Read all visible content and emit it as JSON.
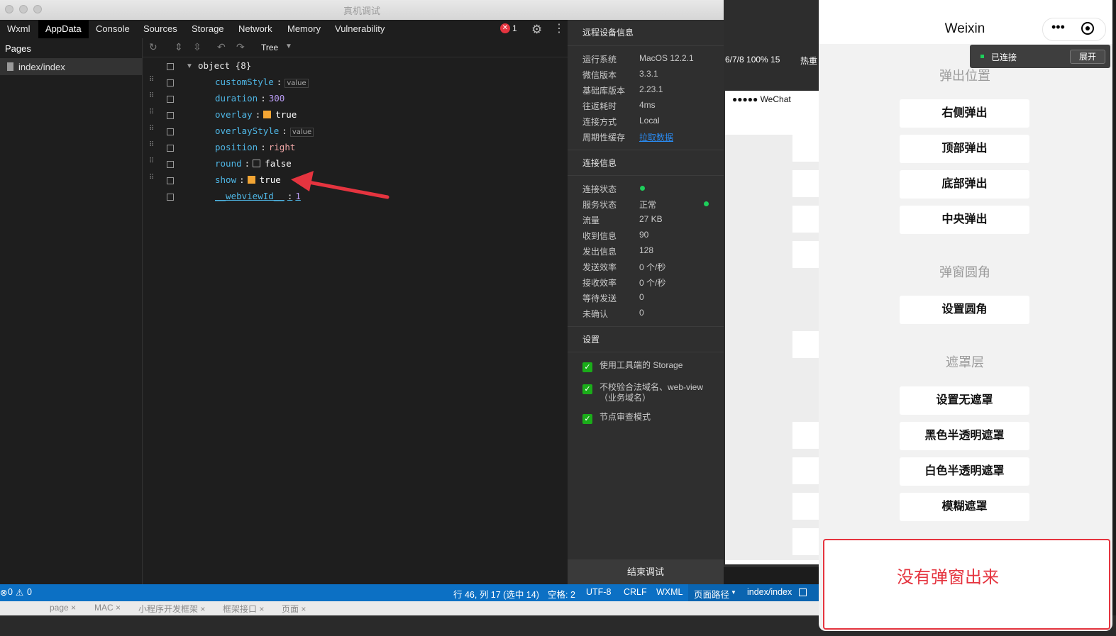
{
  "window": {
    "title": "真机调试"
  },
  "tabs": [
    {
      "label": "Wxml",
      "active": false
    },
    {
      "label": "AppData",
      "active": true
    },
    {
      "label": "Console",
      "active": false
    },
    {
      "label": "Sources",
      "active": false
    },
    {
      "label": "Storage",
      "active": false
    },
    {
      "label": "Network",
      "active": false
    },
    {
      "label": "Memory",
      "active": false
    },
    {
      "label": "Vulnerability",
      "active": false
    }
  ],
  "errors": {
    "count": "1"
  },
  "pages": {
    "title": "Pages",
    "items": [
      "index/index"
    ]
  },
  "toolbar": {
    "view_mode": "Tree"
  },
  "appdata": {
    "root": "object {8}",
    "rows": [
      {
        "key": "customStyle",
        "value": "value",
        "type": "tag"
      },
      {
        "key": "duration",
        "value": "300",
        "type": "num"
      },
      {
        "key": "overlay",
        "value": "true",
        "type": "bool-on"
      },
      {
        "key": "overlayStyle",
        "value": "value",
        "type": "tag"
      },
      {
        "key": "position",
        "value": "right",
        "type": "str"
      },
      {
        "key": "round",
        "value": "false",
        "type": "bool-off"
      },
      {
        "key": "show",
        "value": "true",
        "type": "bool-on"
      },
      {
        "key": "__webviewId__",
        "value": "1",
        "type": "num"
      }
    ]
  },
  "remote": {
    "title": "远程设备信息",
    "rows": [
      {
        "k": "运行系统",
        "v": "MacOS 12.2.1"
      },
      {
        "k": "微信版本",
        "v": "3.3.1"
      },
      {
        "k": "基础库版本",
        "v": "2.23.1"
      },
      {
        "k": "往返耗时",
        "v": "4ms"
      },
      {
        "k": "连接方式",
        "v": "Local"
      },
      {
        "k": "周期性缓存",
        "v": "拉取数据"
      }
    ]
  },
  "connection": {
    "title": "连接信息",
    "rows": [
      {
        "k": "连接状态",
        "v": ""
      },
      {
        "k": "服务状态",
        "v": "正常"
      },
      {
        "k": "流量",
        "v": "27 KB"
      },
      {
        "k": "收到信息",
        "v": "90"
      },
      {
        "k": "发出信息",
        "v": "128"
      },
      {
        "k": "发送效率",
        "v": "0 个/秒"
      },
      {
        "k": "接收效率",
        "v": "0 个/秒"
      },
      {
        "k": "等待发送",
        "v": "0"
      },
      {
        "k": "未确认",
        "v": "0"
      }
    ]
  },
  "settings": {
    "title": "设置",
    "items": [
      "使用工具端的 Storage",
      "不校验合法域名、web-view（业务域名）",
      "节点审查模式"
    ]
  },
  "end_debug": "结束调试",
  "statusbar": {
    "problems_err": "0",
    "problems_warn": "0",
    "cursor": "行 46, 列 17 (选中 14)",
    "spaces": "空格: 2",
    "encoding": "UTF-8",
    "eol": "CRLF",
    "lang": "WXML",
    "page_path_label": "页面路径",
    "page_path": "index/index"
  },
  "bottom_tabs": [
    "page",
    "MAC",
    "小程序开发框架",
    "框架接口",
    "页面"
  ],
  "behind": {
    "toolbar_text": "6/7/8 100% 15",
    "hot": "热重",
    "carrier": "●●●●● WeChat"
  },
  "phone": {
    "title": "Weixin",
    "connection_status": "已连接",
    "expand": "展开",
    "sections": [
      {
        "title": "弹出位置",
        "buttons": [
          "右侧弹出",
          "顶部弹出",
          "底部弹出",
          "中央弹出"
        ]
      },
      {
        "title": "弹窗圆角",
        "buttons": [
          "设置圆角"
        ]
      },
      {
        "title": "遮罩层",
        "buttons": [
          "设置无遮罩",
          "黑色半透明遮罩",
          "白色半透明遮罩",
          "模糊遮罩"
        ]
      }
    ]
  },
  "annotation": {
    "text": "没有弹窗出来"
  },
  "colors": {
    "accent_blue": "#0c70c4",
    "error_red": "#e5343f",
    "ok_green": "#1ecf5b",
    "checkbox_orange": "#f3a534"
  }
}
